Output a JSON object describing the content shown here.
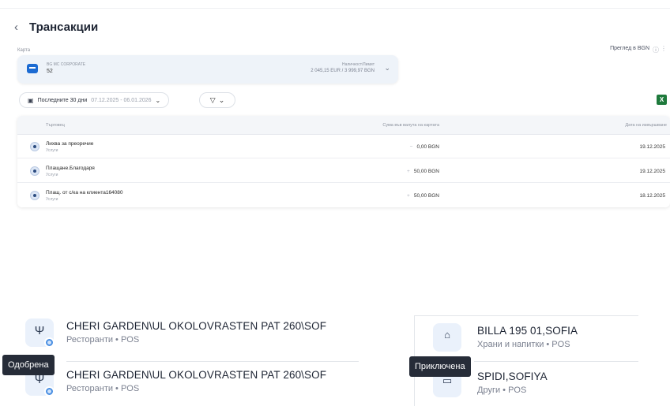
{
  "header": {
    "back_icon": "chevron-left-icon",
    "title": "Трансакции"
  },
  "card": {
    "section_label": "Карта",
    "name": "BG MC CORPORATE",
    "number": "52",
    "available_label": "Наличност/Лимит",
    "available_value": "2 045,15 EUR / 3 999,97 BGN"
  },
  "view_toggle": {
    "label": "Преглед в BGN"
  },
  "filters": {
    "period_label": "Последните 30 дни",
    "period_dates": "07.12.2025 - 06.01.2026"
  },
  "table": {
    "columns": {
      "merchant": "Търговец",
      "amount": "Сума във валута на картата",
      "date": "Дата на извършване"
    },
    "rows": [
      {
        "name": "Лихва за преоречие",
        "category": "Услуги",
        "sign": "−",
        "amount": "0,00 BGN",
        "date": "19.12.2025"
      },
      {
        "name": "Плащане.Благодаря",
        "category": "Услуги",
        "sign": "+",
        "amount": "50,00 BGN",
        "date": "19.12.2025"
      },
      {
        "name": "Плащ. от с/ка на клиента164080",
        "category": "Услуги",
        "sign": "+",
        "amount": "50,00 BGN",
        "date": "18.12.2025"
      }
    ]
  },
  "transactions": [
    {
      "name": "CHERI GARDEN\\UL OKOLOVRASTEN PAT 260\\SOF",
      "category": "Ресторанти • POS",
      "icon": "fork-knife-icon"
    },
    {
      "name": "CHERI GARDEN\\UL OKOLOVRASTEN PAT 260\\SOF",
      "category": "Ресторанти • POS",
      "icon": "fork-knife-icon"
    },
    {
      "name": "BILLA 195 01,SOFIA",
      "category": "Храни и напитки • POS",
      "icon": "shopping-bag-icon"
    },
    {
      "name": "SPIDI,SOFIYA",
      "category": "Други • POS",
      "icon": "card-icon"
    }
  ],
  "tooltips": {
    "approved": "Одобрена",
    "completed": "Приключена"
  },
  "colors": {
    "accent": "#1c6bd2",
    "excel": "#1e7a3c",
    "tooltip_bg": "#262c38"
  }
}
